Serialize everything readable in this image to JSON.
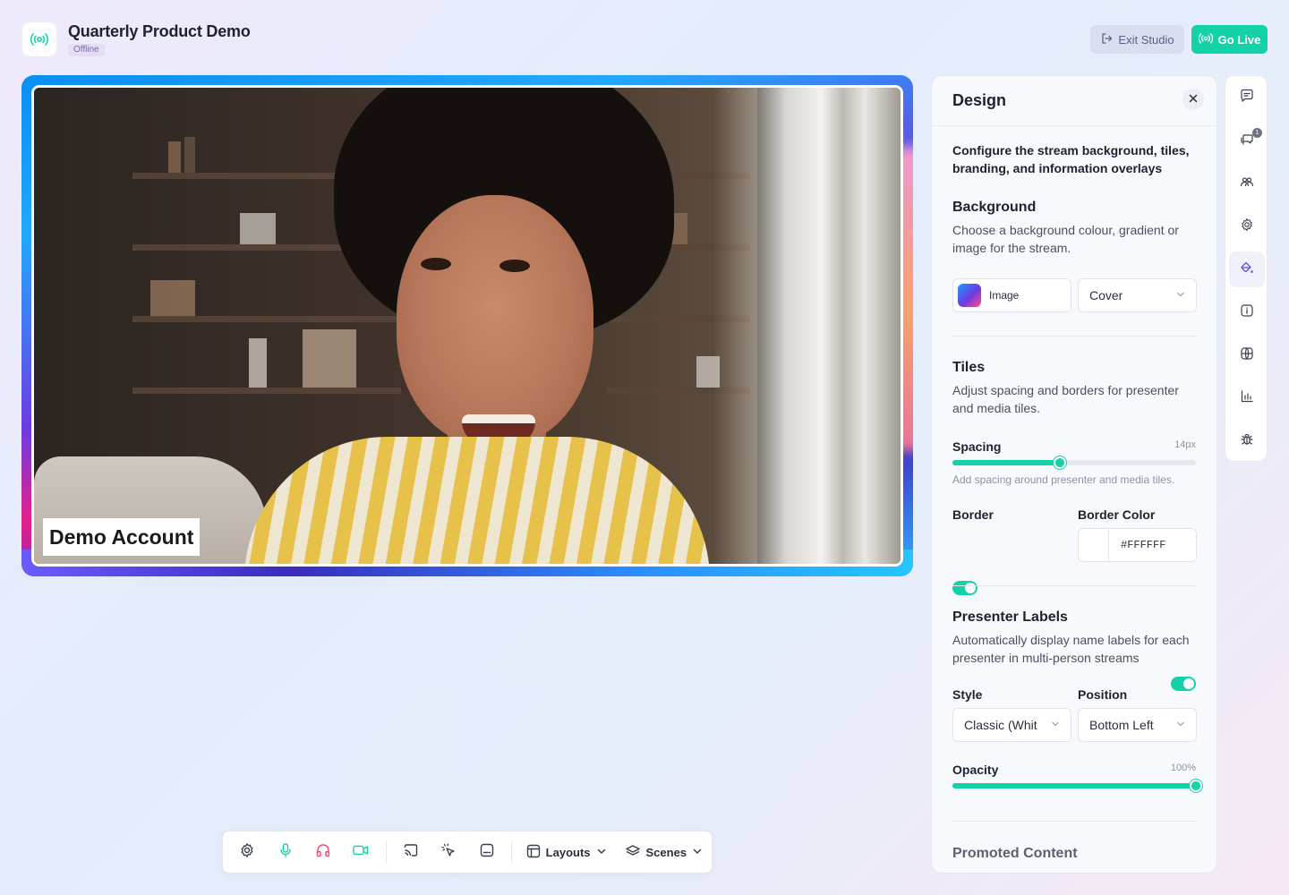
{
  "header": {
    "title": "Quarterly Product Demo",
    "status": "Offline",
    "exit_label": "Exit Studio",
    "golive_label": "Go Live",
    "accent_color": "#14d2a8"
  },
  "stage": {
    "presenter_name": "Demo Account"
  },
  "toolbar": {
    "layouts_label": "Layouts",
    "scenes_label": "Scenes",
    "icons": [
      "gear-icon",
      "microphone-icon",
      "headphones-icon",
      "camera-icon",
      "cast-icon",
      "pointer-click-icon",
      "caption-icon",
      "layout-icon",
      "layers-icon"
    ]
  },
  "panel": {
    "title": "Design",
    "intro": "Configure the stream background, tiles, branding, and information overlays",
    "background": {
      "title": "Background",
      "description": "Choose a background colour, gradient or image for the stream.",
      "type_label": "Image",
      "fit_value": "Cover"
    },
    "tiles": {
      "title": "Tiles",
      "description": "Adjust spacing and borders for presenter and media tiles.",
      "spacing_label": "Spacing",
      "spacing_value": "14px",
      "spacing_fraction": 0.44,
      "spacing_hint": "Add spacing around presenter and media tiles.",
      "border_label": "Border",
      "border_enabled": true,
      "border_color_label": "Border Color",
      "border_color_value": "#FFFFFF"
    },
    "presenter_labels": {
      "title": "Presenter Labels",
      "enabled": true,
      "description": "Automatically display name labels for each presenter in multi-person streams",
      "style_label": "Style",
      "style_value": "Classic (Whit",
      "position_label": "Position",
      "position_value": "Bottom Left",
      "opacity_label": "Opacity",
      "opacity_value": "100%",
      "opacity_fraction": 1.0
    },
    "promoted": {
      "title": "Promoted Content"
    }
  },
  "rail": {
    "icons": [
      "chat-icon",
      "comments-icon",
      "participants-icon",
      "settings-icon",
      "paint-bucket-icon",
      "info-icon",
      "globe-icon",
      "analytics-icon",
      "bug-icon"
    ],
    "comments_badge": "1"
  }
}
